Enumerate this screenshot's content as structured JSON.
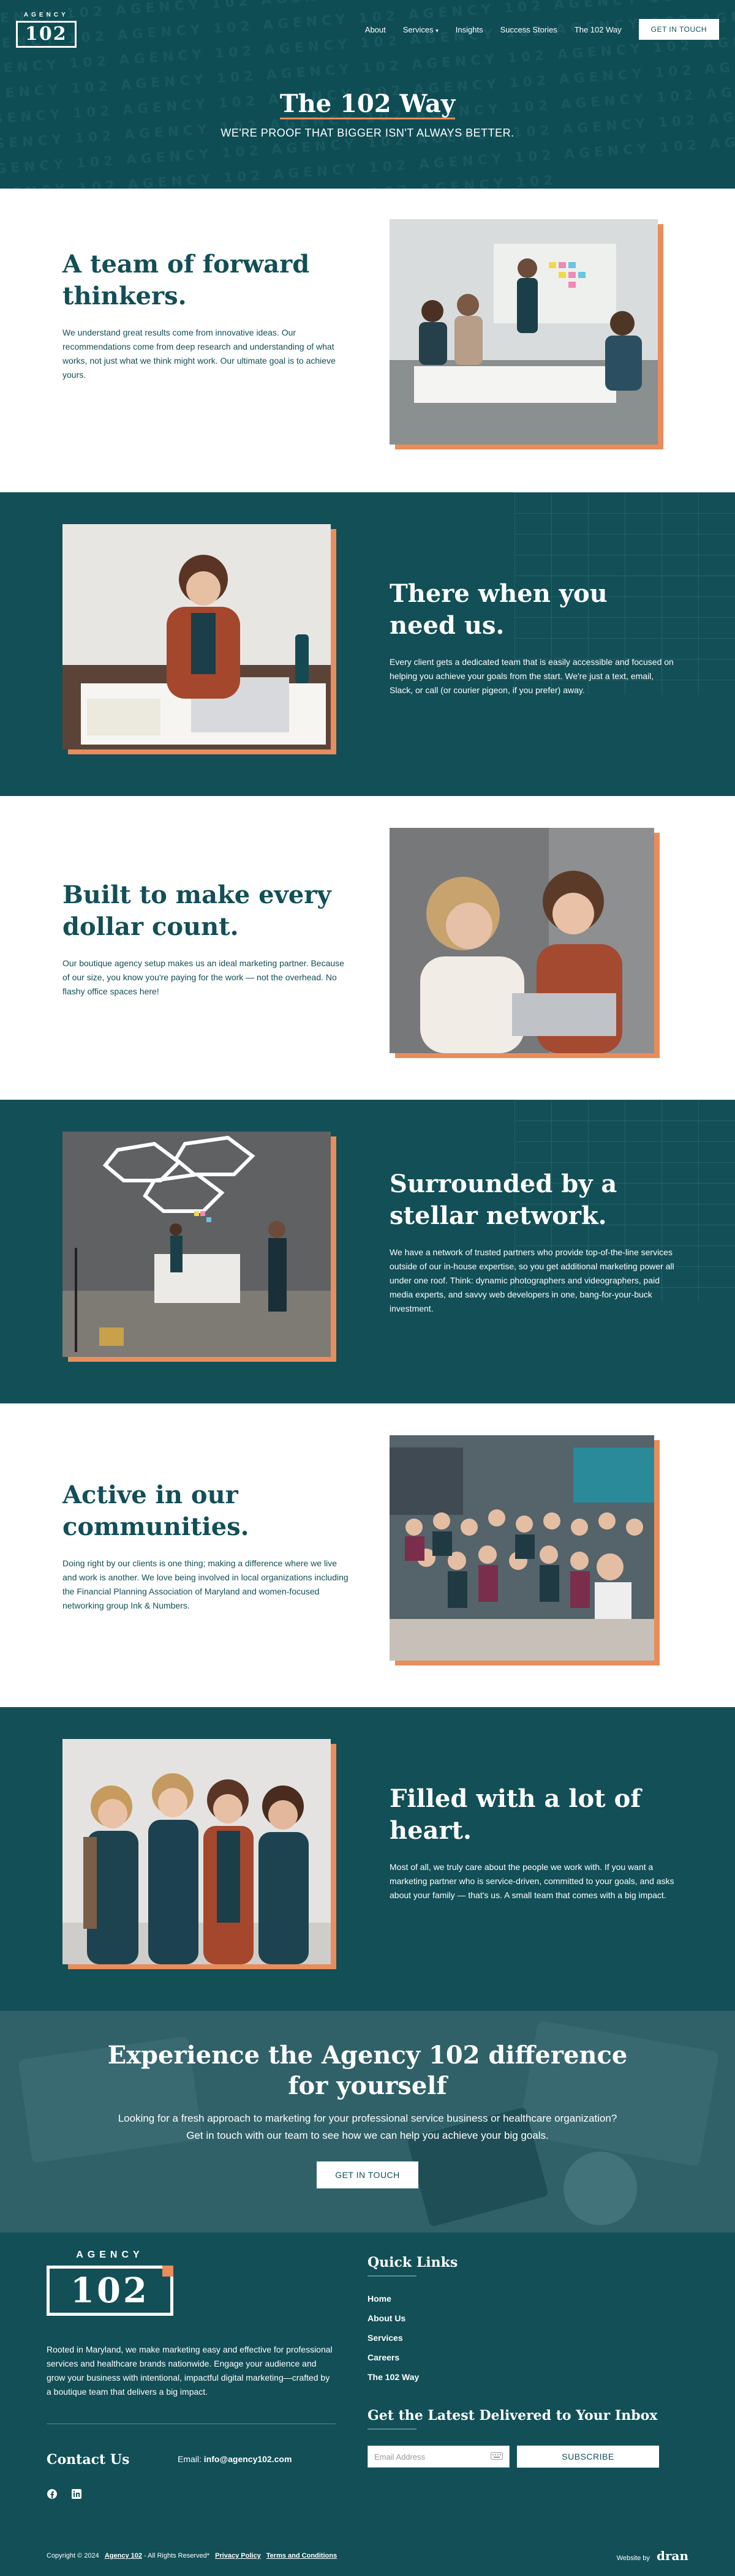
{
  "nav": {
    "logo_small": "AGENCY",
    "logo_number": "102",
    "items": [
      "About",
      "Services",
      "Insights",
      "Success Stories",
      "The 102 Way"
    ],
    "services_chevron": "chevron-down-icon",
    "cta": "GET IN TOUCH"
  },
  "hero": {
    "title": "The 102 Way",
    "subtitle": "WE'RE PROOF THAT BIGGER ISN'T ALWAYS BETTER."
  },
  "sections": [
    {
      "title": "A team of forward thinkers.",
      "body": "We understand great results come from innovative ideas. Our recommendations come from deep research and understanding of what works, not just what we think might work. Our ultimate goal is to achieve yours."
    },
    {
      "title": "There when you need us.",
      "body": "Every client gets a dedicated team that is easily accessible and focused on helping you achieve your goals from the start. We're just a text, email, Slack, or call (or courier pigeon, if you prefer) away."
    },
    {
      "title": "Built to make every dollar count.",
      "body": "Our boutique agency setup makes us an ideal marketing partner. Because of our size, you know you're paying for the work — not the overhead. No flashy office spaces here!"
    },
    {
      "title": "Surrounded by a stellar network.",
      "body": "We have a network of trusted partners who provide top-of-the-line services outside of our in-house expertise, so you get additional marketing power all under one roof. Think: dynamic photographers and videographers, paid media experts, and savvy web developers in one, bang-for-your-buck investment."
    },
    {
      "title": "Active in our communities.",
      "body": "Doing right by our clients is one thing; making a difference where we live and work is another. We love being involved in local organizations including the Financial Planning Association of Maryland and women-focused networking group Ink & Numbers."
    },
    {
      "title": "Filled with a lot of heart.",
      "body": "Most of all, we truly care about the people we work with. If you want a marketing partner who is service-driven, committed to your goals, and asks about your family — that's us. A small team that comes with a big impact."
    }
  ],
  "cta": {
    "title": "Experience the Agency 102 difference for yourself",
    "line1": "Looking for a fresh approach to marketing for your professional service business or healthcare organization?",
    "line2": "Get in touch with our team to see how we can help you achieve your big goals.",
    "button": "GET IN TOUCH"
  },
  "footer": {
    "logo_small": "AGENCY",
    "logo_number": "102",
    "about": "Rooted in Maryland, we make marketing easy and effective for professional services and healthcare brands nationwide. Engage your audience and grow your business with intentional, impactful digital marketing—crafted by a boutique team that delivers a big impact.",
    "contact_title": "Contact Us",
    "email_label": "Email:",
    "email": "info@agency102.com",
    "social": [
      "facebook-icon",
      "linkedin-icon"
    ],
    "quick_links_title": "Quick Links",
    "quick_links": [
      "Home",
      "About Us",
      "Services",
      "Careers",
      "The 102 Way"
    ],
    "newsletter_title": "Get the Latest Delivered to Your Inbox",
    "email_placeholder": "Email Address",
    "subscribe": "SUBSCRIBE",
    "copyright": "Copyright © 2024",
    "copyright_brand": "Agency 102",
    "rights": "- All Rights Reserved*",
    "privacy": "Privacy Policy",
    "terms": "Terms and Conditions",
    "website_by": "Website by",
    "website_by_brand": "dran"
  },
  "colors": {
    "teal": "#124f57",
    "accent": "#e88d5b",
    "white": "#ffffff"
  }
}
